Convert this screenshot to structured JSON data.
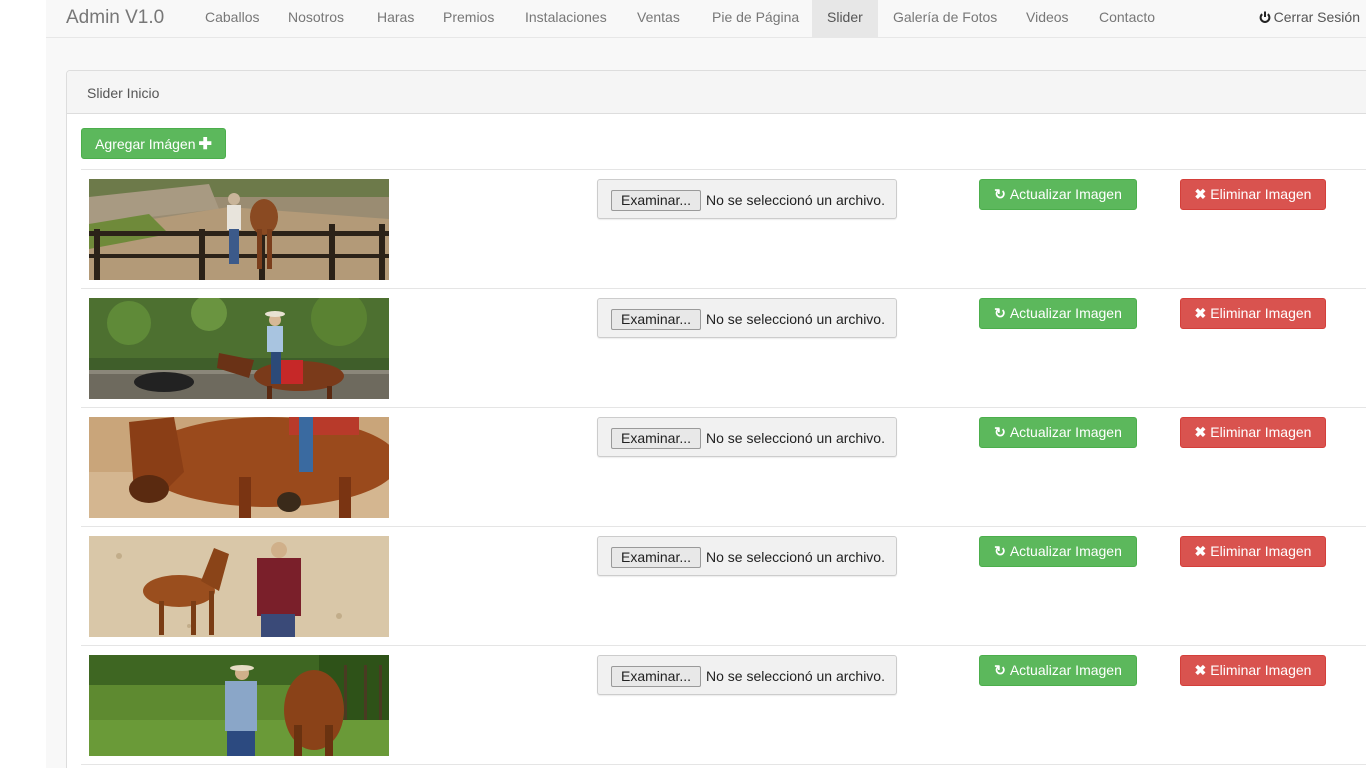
{
  "navbar": {
    "brand": "Admin V1.0",
    "items": [
      {
        "label": "Caballos"
      },
      {
        "label": "Nosotros"
      },
      {
        "label": "Haras"
      },
      {
        "label": "Premios"
      },
      {
        "label": "Instalaciones"
      },
      {
        "label": "Ventas"
      },
      {
        "label": "Pie de Página"
      },
      {
        "label": "Slider",
        "active": true
      },
      {
        "label": "Galería de Fotos"
      },
      {
        "label": "Videos"
      },
      {
        "label": "Contacto"
      }
    ],
    "logout_label": "Cerrar Sesión",
    "logout_icon": "power-icon"
  },
  "panel": {
    "title": "Slider Inicio",
    "add_button_label": "Agregar Imágen",
    "add_button_icon": "plus-icon"
  },
  "slides": [
    {
      "file_button": "Examinar...",
      "file_status": "No se seleccionó un archivo.",
      "update_label": "Actualizar Imagen",
      "delete_label": "Eliminar Imagen",
      "image": "horse-fence-photo"
    },
    {
      "file_button": "Examinar...",
      "file_status": "No se seleccionó un archivo.",
      "update_label": "Actualizar Imagen",
      "delete_label": "Eliminar Imagen",
      "image": "rider-horse-photo"
    },
    {
      "file_button": "Examinar...",
      "file_status": "No se seleccionó un archivo.",
      "update_label": "Actualizar Imagen",
      "delete_label": "Eliminar Imagen",
      "image": "horse-closeup-photo"
    },
    {
      "file_button": "Examinar...",
      "file_status": "No se seleccionó un archivo.",
      "update_label": "Actualizar Imagen",
      "delete_label": "Eliminar Imagen",
      "image": "man-foal-photo"
    },
    {
      "file_button": "Examinar...",
      "file_status": "No se seleccionó un archivo.",
      "update_label": "Actualizar Imagen",
      "delete_label": "Eliminar Imagen",
      "image": "man-horse-field-photo"
    }
  ],
  "colors": {
    "success": "#5cb85c",
    "danger": "#d9534f",
    "navbar_bg": "#f8f8f8",
    "nav_active_bg": "#e7e7e7"
  }
}
